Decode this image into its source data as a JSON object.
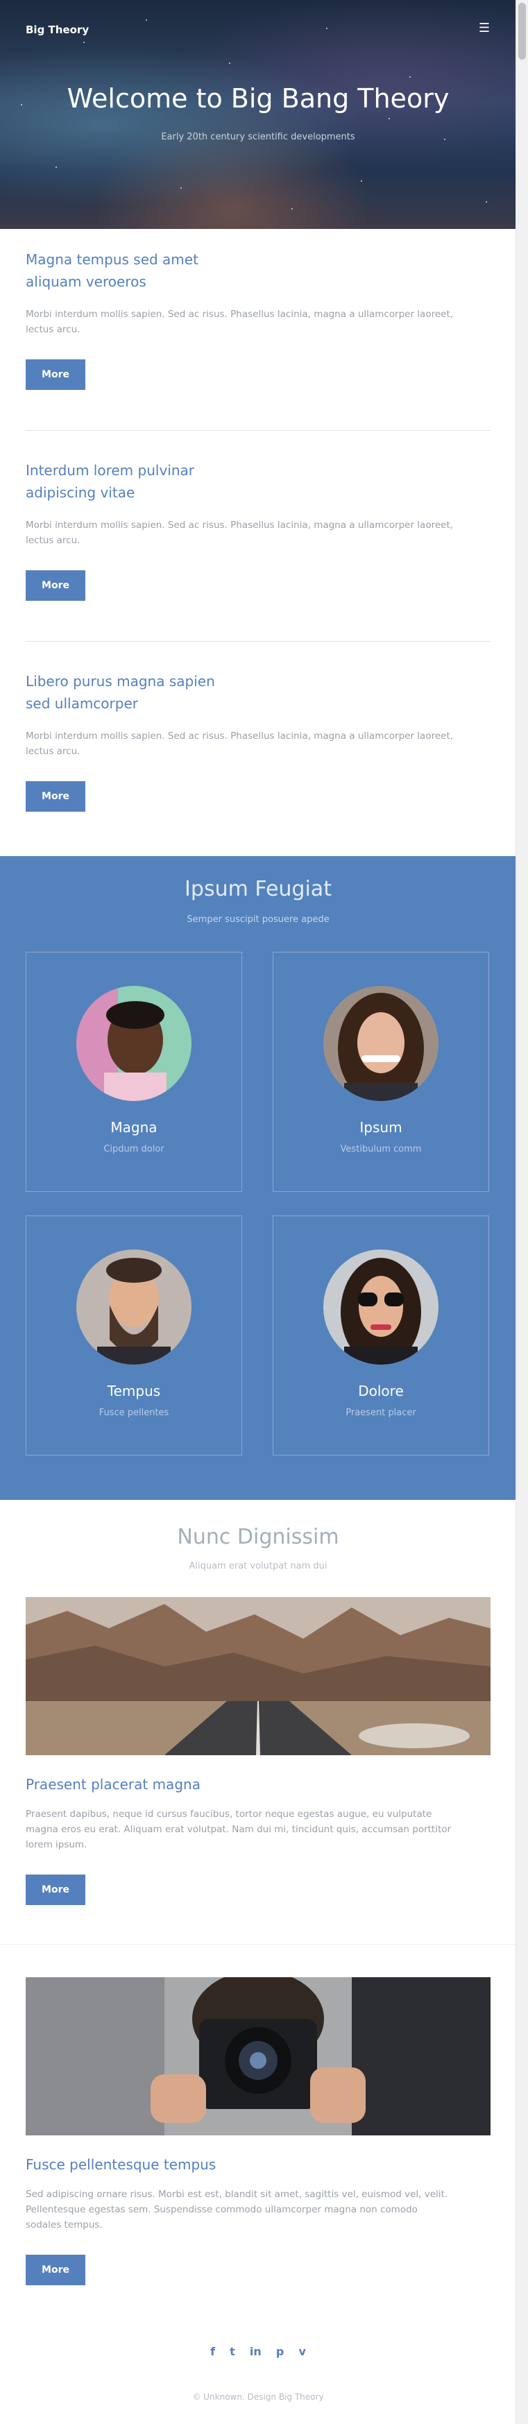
{
  "header": {
    "brand": "Big Theory",
    "menu_icon": "☰",
    "title": "Welcome to Big Bang Theory",
    "subtitle": "Early 20th century scientific developments"
  },
  "posts": [
    {
      "title_line1": "Magna tempus sed amet",
      "title_line2": "aliquam veroeros",
      "text_line1": "Morbi interdum mollis sapien. Sed ac risus. Phasellus lacinia, magna a ullamcorper laoreet,",
      "text_line2": "lectus arcu.",
      "button": "More"
    },
    {
      "title_line1": "Interdum lorem pulvinar",
      "title_line2": "adipiscing vitae",
      "text_line1": "Morbi interdum mollis sapien. Sed ac risus. Phasellus lacinia, magna a ullamcorper laoreet,",
      "text_line2": "lectus arcu.",
      "button": "More"
    },
    {
      "title_line1": "Libero purus magna sapien",
      "title_line2": "sed ullamcorper",
      "text_line1": "Morbi interdum mollis sapien. Sed ac risus. Phasellus lacinia, magna a ullamcorper laoreet,",
      "text_line2": "lectus arcu.",
      "button": "More"
    }
  ],
  "team": {
    "title": "Ipsum Feugiat",
    "subtitle": "Semper suscipit posuere apede",
    "members": [
      {
        "name": "Magna",
        "role": "Cipdum dolor"
      },
      {
        "name": "Ipsum",
        "role": "Vestibulum comm"
      },
      {
        "name": "Tempus",
        "role": "Fusce pellentes"
      },
      {
        "name": "Dolore",
        "role": "Praesent placer"
      }
    ]
  },
  "features": {
    "title": "Nunc Dignissim",
    "subtitle": "Aliquam erat volutpat nam dui",
    "items": [
      {
        "image_icon": "mountain-road-photo",
        "title": "Praesent placerat magna",
        "text_line1": "Praesent dapibus, neque id cursus faucibus, tortor neque egestas augue, eu vulputate",
        "text_line2": "magna eros eu erat. Aliquam erat volutpat. Nam dui mi, tincidunt quis, accumsan porttitor",
        "text_line3": "lorem ipsum.",
        "button": "More"
      },
      {
        "image_icon": "camera-photographer-photo",
        "title": "Fusce pellentesque tempus",
        "text_line1": "Sed adipiscing ornare risus. Morbi est est, blandit sit amet, sagittis vel, euismod vel, velit.",
        "text_line2": "Pellentesque egestas sem. Suspendisse commodo ullamcorper magna non comodo",
        "text_line3": "sodales tempus.",
        "button": "More"
      }
    ]
  },
  "footer": {
    "social": [
      "f",
      "t",
      "in",
      "p",
      "v"
    ],
    "copyright": "© Unknown. Design Big Theory"
  },
  "colors": {
    "accent": "#5480bd",
    "team_bg": "#5482bd",
    "text_muted": "#9aa0a8"
  }
}
